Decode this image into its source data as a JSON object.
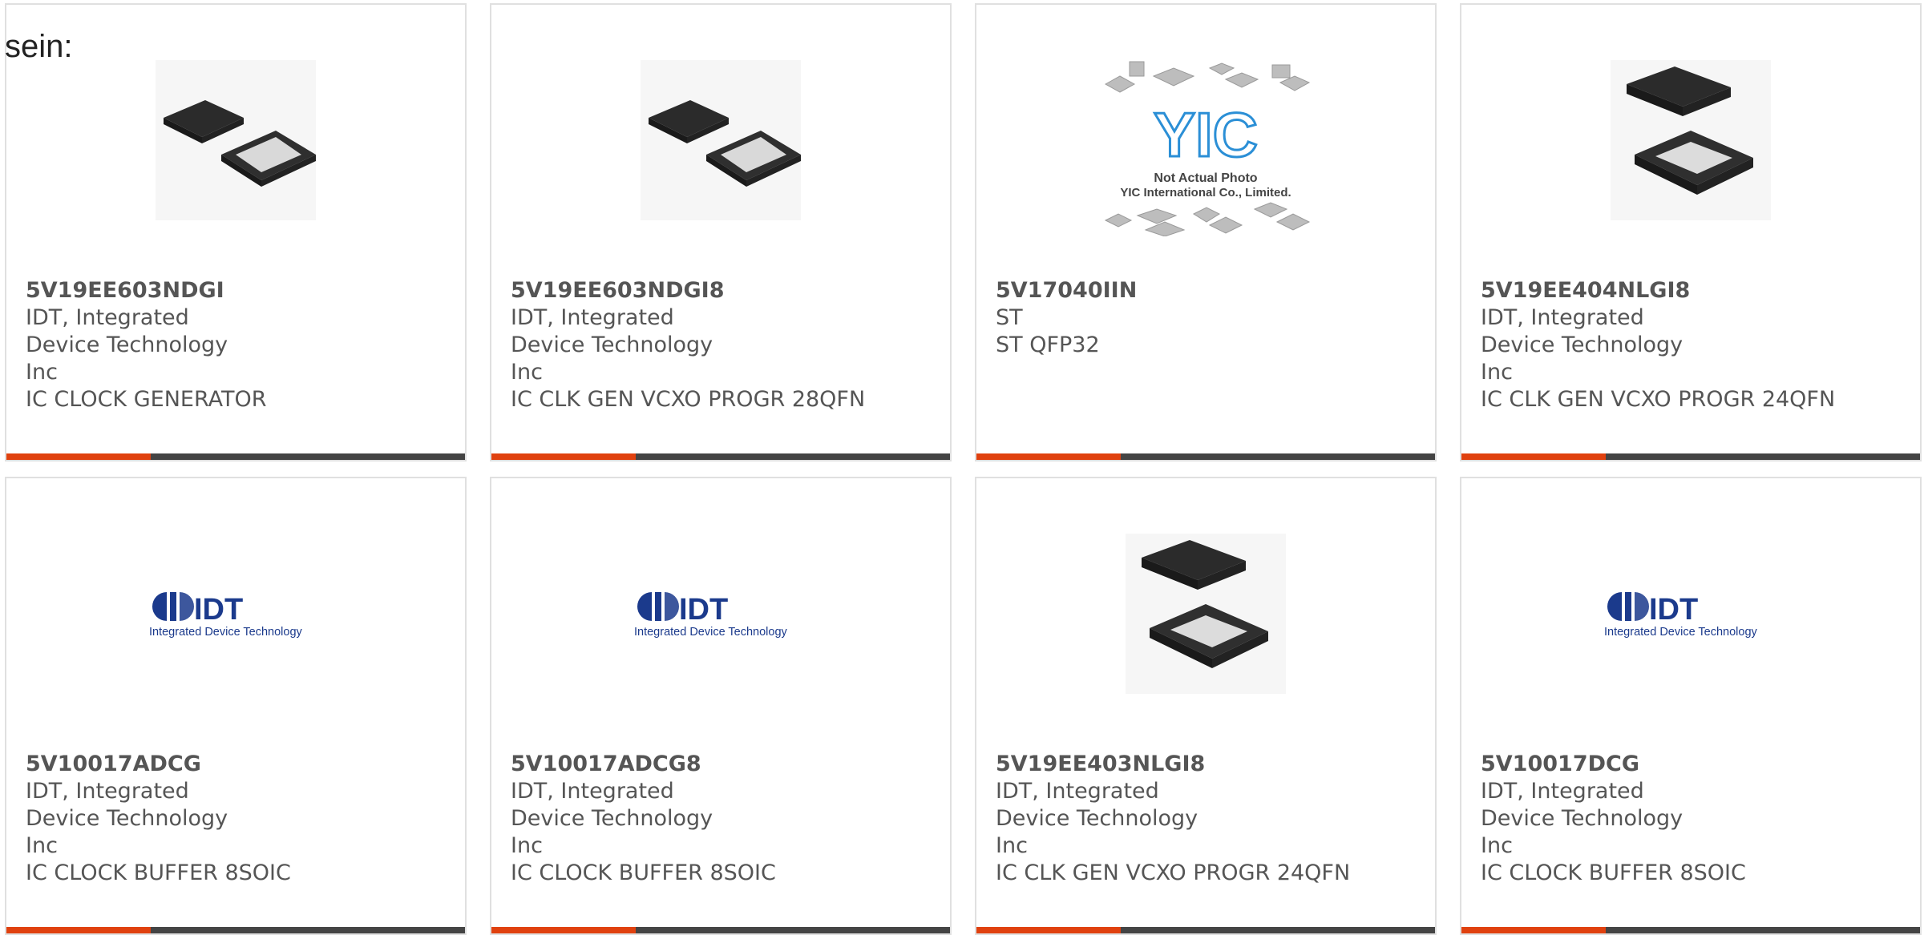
{
  "page": {
    "lead_text": "sein:"
  },
  "products": [
    {
      "part": "5V19EE603NDGI",
      "mfr": "IDT, Integrated Device Technology Inc",
      "desc": "IC CLOCK GENERATOR",
      "image": "qfn-chip-pair"
    },
    {
      "part": "5V19EE603NDGI8",
      "mfr": "IDT, Integrated Device Technology Inc",
      "desc": "IC CLK GEN VCXO PROGR 28QFN",
      "image": "qfn-chip-pair"
    },
    {
      "part": "5V17040IIN",
      "mfr": "ST",
      "desc": "ST QFP32",
      "image": "yic-placeholder",
      "image_text": {
        "brand": "YIC",
        "line1": "Not Actual Photo",
        "line2": "YIC International Co., Limited."
      }
    },
    {
      "part": "5V19EE404NLGI8",
      "mfr": "IDT, Integrated Device Technology Inc",
      "desc": "IC CLK GEN VCXO PROGR 24QFN",
      "image": "qfn-chip-stacked"
    },
    {
      "part": "5V10017ADCG",
      "mfr": "IDT, Integrated Device Technology Inc",
      "desc": "IC CLOCK BUFFER 8SOIC",
      "image": "idt-logo",
      "image_text": {
        "brand": "IDT",
        "tagline": "Integrated Device Technology"
      }
    },
    {
      "part": "5V10017ADCG8",
      "mfr": "IDT, Integrated Device Technology Inc",
      "desc": "IC CLOCK BUFFER 8SOIC",
      "image": "idt-logo",
      "image_text": {
        "brand": "IDT",
        "tagline": "Integrated Device Technology"
      }
    },
    {
      "part": "5V19EE403NLGI8",
      "mfr": "IDT, Integrated Device Technology Inc",
      "desc": "IC CLK GEN VCXO PROGR 24QFN",
      "image": "qfn-chip-stacked"
    },
    {
      "part": "5V10017DCG",
      "mfr": "IDT, Integrated Device Technology Inc",
      "desc": "IC CLOCK BUFFER 8SOIC",
      "image": "idt-logo",
      "image_text": {
        "brand": "IDT",
        "tagline": "Integrated Device Technology"
      }
    }
  ],
  "colors": {
    "accent": "#e0410f",
    "bar": "#444444",
    "text": "#555555",
    "idt_blue": "#1b3a8c",
    "yic_blue": "#2b8fd6"
  }
}
